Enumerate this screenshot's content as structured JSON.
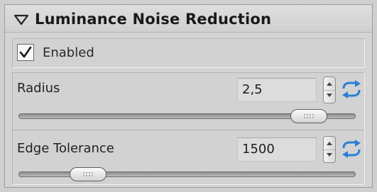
{
  "panel": {
    "title": "Luminance Noise Reduction",
    "enabled": {
      "label": "Enabled",
      "checked": true
    }
  },
  "params": {
    "radius": {
      "label": "Radius",
      "value": "2,5",
      "slider_position": 0.9
    },
    "edge_tolerance": {
      "label": "Edge Tolerance",
      "value": "1500",
      "slider_position": 0.17
    }
  },
  "icons": {
    "collapse": "triangle-down-icon",
    "check": "checkmark-icon",
    "spin_up": "spinner-up-icon",
    "spin_down": "spinner-down-icon",
    "reset": "reset-arrows-icon"
  },
  "colors": {
    "reset_icon": "#2b7fd8"
  }
}
